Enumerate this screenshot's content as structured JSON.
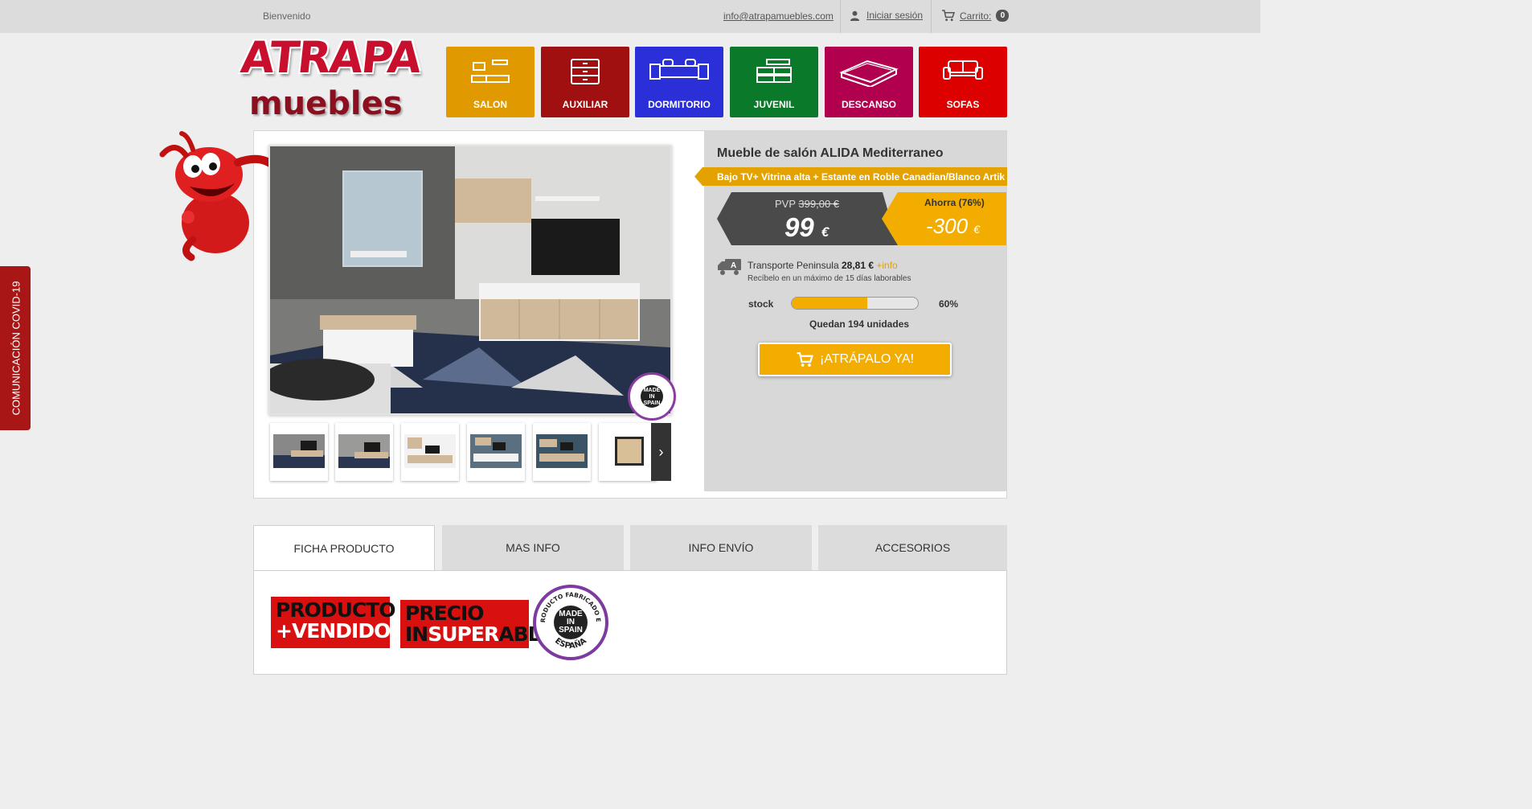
{
  "topbar": {
    "welcome": "Bienvenido",
    "email": "info@atrapamuebles.com",
    "login": "Iniciar sesión",
    "cart_label": "Carrito:",
    "cart_count": "0"
  },
  "logo": {
    "line1": "ATRAPA",
    "line2": "muebles"
  },
  "categories": [
    {
      "label": "SALON",
      "color": "#e09a00"
    },
    {
      "label": "AUXILIAR",
      "color": "#a01010"
    },
    {
      "label": "DORMITORIO",
      "color": "#2b2fd8"
    },
    {
      "label": "JUVENIL",
      "color": "#0a7a2a"
    },
    {
      "label": "DESCANSO",
      "color": "#b0004e"
    },
    {
      "label": "SOFAS",
      "color": "#dd0000"
    }
  ],
  "covid": "COMUNICACIÓN COVID-19",
  "product": {
    "title": "Mueble de salón ALIDA Mediterraneo",
    "subtitle": "Bajo TV+ Vitrina alta + Estante en Roble Canadian/Blanco Artik",
    "pvp_label": "PVP",
    "pvp_old": "399,00 €",
    "price": "99",
    "currency": "€",
    "save_label": "Ahorra (76%)",
    "save_amount": "-300",
    "made_badge": "MADE IN SPAIN"
  },
  "shipping": {
    "label": "Transporte Peninsula",
    "cost": "28,81 €",
    "more": "+info",
    "note": "Recíbelo en un máximo de 15 días laborables"
  },
  "stock": {
    "label": "stock",
    "level": 0.6,
    "percent_text": "60%",
    "remaining": "Quedan 194 unidades"
  },
  "buy_button": "¡ATRÁPALO YA!",
  "tabs": [
    "FICHA PRODUCTO",
    "MAS INFO",
    "INFO ENVÍO",
    "ACCESORIOS"
  ],
  "promos": {
    "p1_line1": "PRODUCTO",
    "p1_line2": "+VENDIDO",
    "p2_line1": "PRECIO",
    "p2_line2a": "IN",
    "p2_line2b": "SUPER",
    "p2_line2c": "ABLE",
    "badge_center": "MADE IN SPAIN",
    "badge_ring_top": "PRODUCTO FABRICADO EN",
    "badge_ring_bottom": "ESPAÑA"
  },
  "colors": {
    "accent": "#f3ac00",
    "dark": "#4a4a4a",
    "brand": "#c8102e"
  }
}
